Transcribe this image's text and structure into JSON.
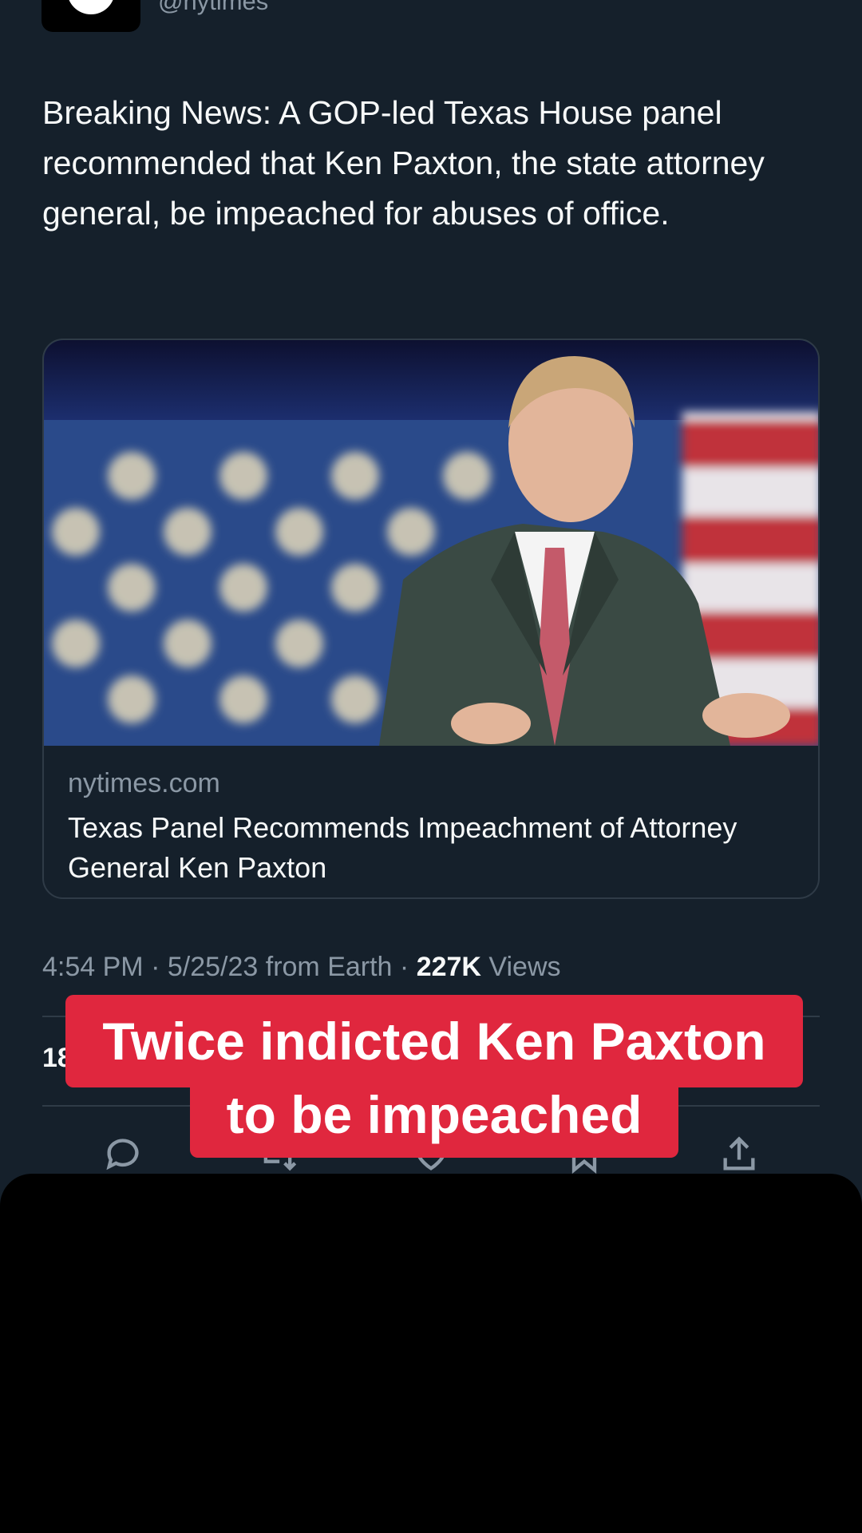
{
  "header": {
    "handle": "@nytimes",
    "avatar_icon": "nyt-logo-icon"
  },
  "tweet": {
    "text": "Breaking News: A GOP-led Texas House panel recommended that Ken Paxton, the state attorney general, be impeached for abuses of office."
  },
  "card": {
    "domain": "nytimes.com",
    "title": "Texas Panel Recommends Impeachment of Attorney General Ken Paxton",
    "image_description_icon": "article-photo"
  },
  "meta": {
    "time": "4:54 PM",
    "date": "5/25/23",
    "source": "from Earth",
    "views_count": "227K",
    "views_label": "Views"
  },
  "stats": {
    "partial_text": "18"
  },
  "actions": [
    "reply-icon",
    "retweet-icon",
    "like-icon",
    "bookmark-icon",
    "share-icon"
  ],
  "caption": {
    "line1": "Twice indicted Ken Paxton",
    "line2": "to be impeached",
    "color": "#e0273e"
  },
  "colors": {
    "background": "#15202b",
    "text_primary": "#f7f9f9",
    "text_secondary": "#8b98a5",
    "border": "#2f3b47"
  }
}
